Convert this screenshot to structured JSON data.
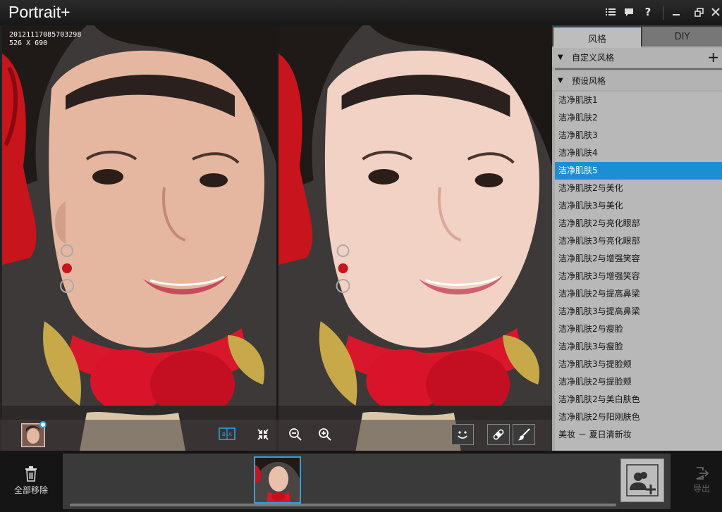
{
  "app": {
    "title": "Portrait+",
    "controls": [
      "list-icon",
      "comment-icon",
      "help-icon",
      "minimize-icon",
      "restore-icon",
      "close-icon"
    ]
  },
  "viewer": {
    "image_name": "20121117085703298",
    "image_size": "526 X 690",
    "toolbar": [
      "before-after-thumbnail",
      "split-compare-icon",
      "fit-to-window-icon",
      "zoom-out-icon",
      "zoom-in-icon",
      "face-detect-icon",
      "healing-tool-icon",
      "brush-tool-icon"
    ]
  },
  "sidebar": {
    "tabs": [
      {
        "label": "风格",
        "active": true
      },
      {
        "label": "DIY",
        "active": false
      }
    ],
    "sections": {
      "custom": "自定义风格",
      "preset": "预设风格"
    },
    "presets": [
      "洁净肌肤1",
      "洁净肌肤2",
      "洁净肌肤3",
      "洁净肌肤4",
      "洁净肌肤5",
      "洁净肌肤2与美化",
      "洁净肌肤3与美化",
      "洁净肌肤2与亮化眼部",
      "洁净肌肤3与亮化眼部",
      "洁净肌肤2与增强笑容",
      "洁净肌肤3与增强笑容",
      "洁净肌肤2与提高鼻梁",
      "洁净肌肤3与提高鼻梁",
      "洁净肌肤2与瘦脸",
      "洁净肌肤3与瘦脸",
      "洁净肌肤3与提脸颊",
      "洁净肌肤2与提脸颊",
      "洁净肌肤2与美白肤色",
      "洁净肌肤2与阳刚肤色",
      "美妆 － 夏日清新妆"
    ],
    "selected_preset": "洁净肌肤5"
  },
  "bottom": {
    "remove_all": "全部移除",
    "export": "导出"
  },
  "colors": {
    "accent": "#2ea0e0",
    "selection": "#1c8fd2",
    "panel": "#a9a9a9"
  }
}
